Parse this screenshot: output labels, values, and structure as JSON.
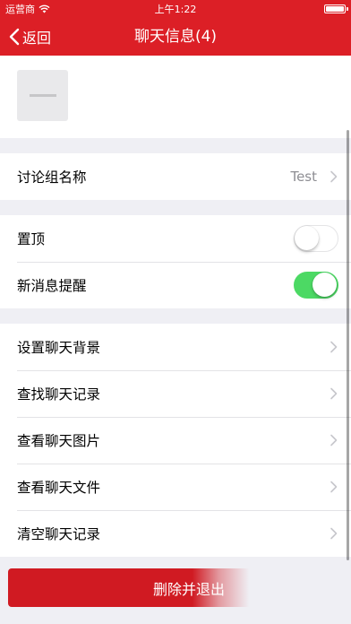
{
  "status_bar": {
    "carrier": "运营商",
    "time": "上午1:22"
  },
  "nav": {
    "back_label": "返回",
    "title": "聊天信息(4)"
  },
  "group_name": {
    "label": "讨论组名称",
    "value": "Test"
  },
  "toggles": [
    {
      "label": "置顶",
      "on": false
    },
    {
      "label": "新消息提醒",
      "on": true
    }
  ],
  "menu_items": [
    {
      "label": "设置聊天背景"
    },
    {
      "label": "查找聊天记录"
    },
    {
      "label": "查看聊天图片"
    },
    {
      "label": "查看聊天文件"
    },
    {
      "label": "清空聊天记录"
    }
  ],
  "delete_button": {
    "label": "删除并退出"
  },
  "colors": {
    "brand_red": "#dc1f26",
    "toggle_on": "#4cd964",
    "background": "#efeff4"
  },
  "icons": {
    "back": "chevron-left-icon",
    "row_arrow": "chevron-right-icon",
    "wifi": "wifi-icon",
    "battery": "battery-icon"
  }
}
